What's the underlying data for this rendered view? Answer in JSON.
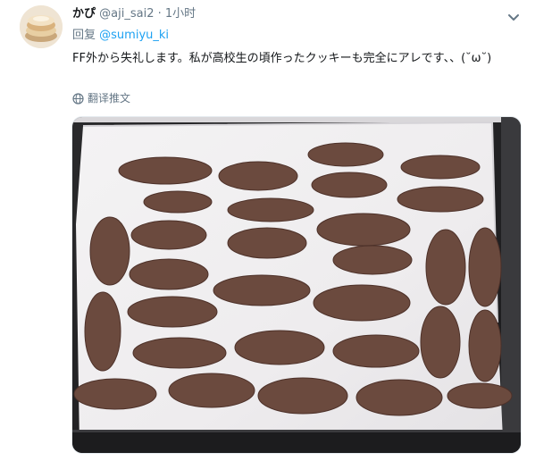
{
  "tweet": {
    "display_name": "かぴ",
    "handle": "@aji_sai2",
    "separator": "·",
    "time": "1小时",
    "reply_prefix": "回复",
    "reply_to": "@sumiyu_ki",
    "text": "FF外から失礼します。私が高校生の頃作ったクッキーも完全にアレです、、(˘ω˘)",
    "translate_label": "翻译推文"
  },
  "icons": {
    "chevron": "chevron-down-icon",
    "globe": "globe-icon"
  },
  "colors": {
    "link": "#1da1f2",
    "secondary_text": "#657786",
    "primary_text": "#14171a"
  }
}
